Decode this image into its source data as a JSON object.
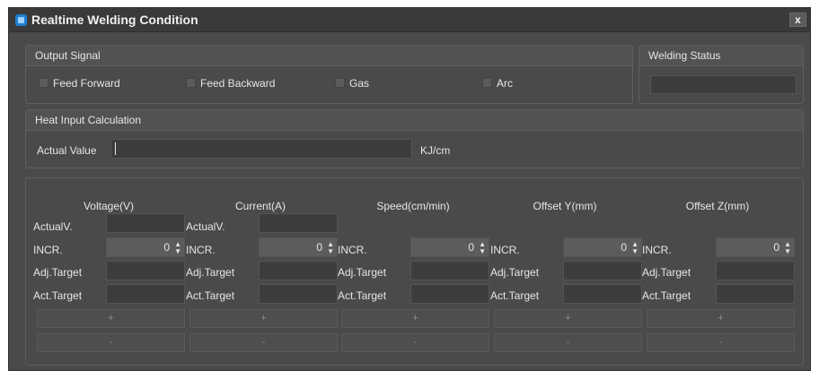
{
  "window": {
    "title": "Realtime Welding Condition",
    "close_label": "x"
  },
  "output_signal": {
    "title": "Output Signal",
    "checkboxes": [
      "Feed Forward",
      "Feed Backward",
      "Gas",
      "Arc"
    ]
  },
  "welding_status": {
    "title": "Welding Status"
  },
  "heat_input": {
    "title": "Heat Input Calculation",
    "actual_label": "Actual Value",
    "unit": "KJ/cm"
  },
  "axes": [
    {
      "header": "Voltage(V)",
      "actual_label": "ActualV.",
      "incr_label": "INCR.",
      "incr_value": "0",
      "adj_label": "Adj.Target",
      "act_label": "Act.Target",
      "plus": "+",
      "minus": "-"
    },
    {
      "header": "Current(A)",
      "actual_label": "ActualV.",
      "incr_label": "INCR.",
      "incr_value": "0",
      "adj_label": "Adj.Target",
      "act_label": "Act.Target",
      "plus": "+",
      "minus": "-"
    },
    {
      "header": "Speed(cm/min)",
      "incr_label": "INCR.",
      "incr_value": "0",
      "adj_label": "Adj.Target",
      "act_label": "Act.Target",
      "plus": "+",
      "minus": "-"
    },
    {
      "header": "Offset Y(mm)",
      "incr_label": "INCR.",
      "incr_value": "0",
      "adj_label": "Adj.Target",
      "act_label": "Act.Target",
      "plus": "+",
      "minus": "-"
    },
    {
      "header": "Offset Z(mm)",
      "incr_label": "INCR.",
      "incr_value": "0",
      "adj_label": "Adj.Target",
      "act_label": "Act.Target",
      "plus": "+",
      "minus": "-"
    }
  ],
  "colors": {
    "background": "#4a4a4a",
    "titlebar": "#3a3a3a",
    "field": "#3d3d3d",
    "accent_icon": "#1e7fd4"
  }
}
